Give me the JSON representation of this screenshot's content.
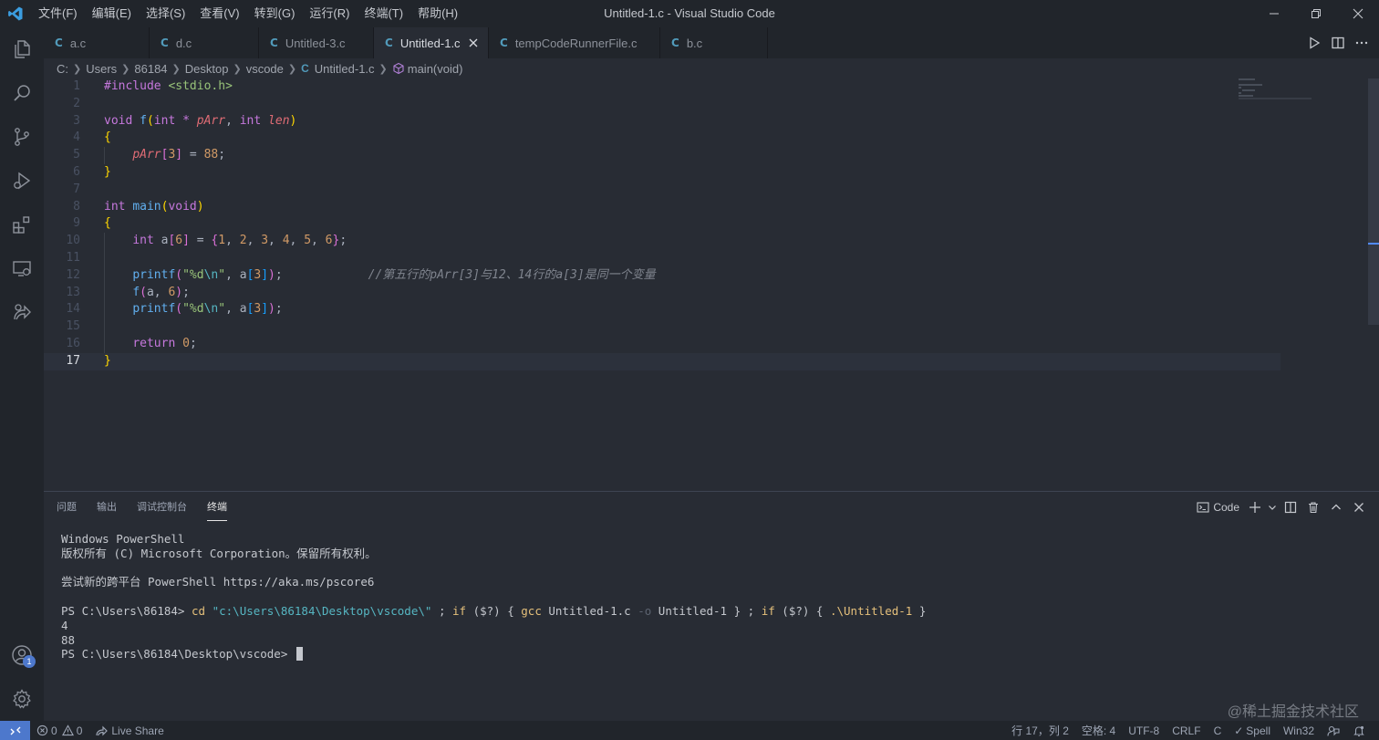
{
  "window": {
    "title": "Untitled-1.c - Visual Studio Code",
    "menu": [
      "文件(F)",
      "编辑(E)",
      "选择(S)",
      "查看(V)",
      "转到(G)",
      "运行(R)",
      "终端(T)",
      "帮助(H)"
    ]
  },
  "tabs": [
    {
      "icon": "C",
      "label": "a.c"
    },
    {
      "icon": "C",
      "label": "d.c"
    },
    {
      "icon": "C",
      "label": "Untitled-3.c"
    },
    {
      "icon": "C",
      "label": "Untitled-1.c",
      "active": true
    },
    {
      "icon": "C",
      "label": "tempCodeRunnerFile.c"
    },
    {
      "icon": "C",
      "label": "b.c"
    }
  ],
  "breadcrumb": {
    "parts": [
      "C:",
      "Users",
      "86184",
      "Desktop",
      "vscode"
    ],
    "file_icon": "C",
    "file": "Untitled-1.c",
    "symbol": "main(void)"
  },
  "editor": {
    "current_line": 17,
    "line_numbers": [
      "1",
      "2",
      "3",
      "4",
      "5",
      "6",
      "7",
      "8",
      "9",
      "10",
      "11",
      "12",
      "13",
      "14",
      "15",
      "16",
      "17"
    ]
  },
  "panel": {
    "tabs": [
      "问题",
      "输出",
      "调试控制台",
      "终端"
    ],
    "active_tab": "终端",
    "terminal_name": "Code",
    "terminal": {
      "l1": "Windows PowerShell",
      "l2": "版权所有 (C) Microsoft Corporation。保留所有权利。",
      "l3": "尝试新的跨平台 PowerShell https://aka.ms/pscore6",
      "prompt": "PS C:\\Users\\86184> ",
      "cmd_cd": "cd",
      "cmd_path": "\"c:\\Users\\86184\\Desktop\\vscode\\\"",
      "cmd_sep1": " ; ",
      "cmd_if1": "if",
      "cmd_cond1": " ($?) { ",
      "cmd_gcc": "gcc",
      "cmd_file": " Untitled-1.c ",
      "cmd_flag": "-o",
      "cmd_out": " Untitled-1 } ; ",
      "cmd_if2": "if",
      "cmd_cond2": " ($?) { ",
      "cmd_run": ".\\Untitled-1",
      "cmd_end": " }",
      "out1": "4",
      "out2": "88",
      "prompt2": "PS C:\\Users\\86184\\Desktop\\vscode> "
    }
  },
  "status": {
    "errors": "0",
    "warnings": "0",
    "live_share": "Live Share",
    "position": "行 17，列 2",
    "spaces": "空格: 4",
    "encoding": "UTF-8",
    "eol": "CRLF",
    "language": "C",
    "spell": "Spell",
    "platform": "Win32"
  },
  "watermark": "@稀土掘金技术社区",
  "colors": {
    "accent": "#4d78cc",
    "background": "#282c34",
    "chrome": "#21252b"
  }
}
